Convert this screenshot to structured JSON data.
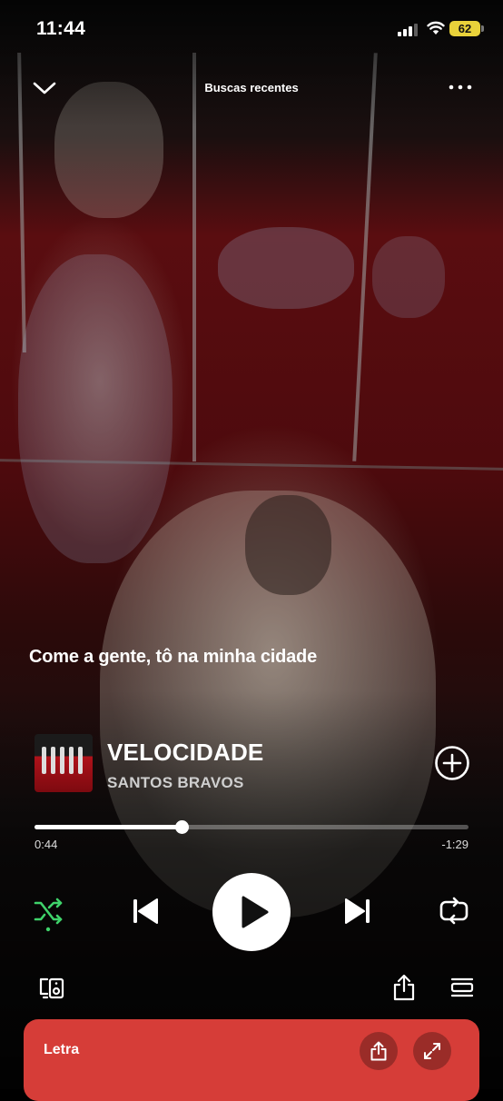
{
  "status_bar": {
    "time": "11:44",
    "battery": "62"
  },
  "header": {
    "title": "Buscas recentes",
    "collapse_icon": "chevron-down-icon",
    "more_icon": "more-icon"
  },
  "lyric_line": "Come a gente, tô na minha cidade",
  "track": {
    "title": "VELOCIDADE",
    "artist": "SANTOS BRAVOS"
  },
  "playback": {
    "elapsed": "0:44",
    "remaining": "-1:29",
    "progress_fraction": 0.338
  },
  "controls": {
    "shuffle_icon": "shuffle-icon",
    "shuffle_color": "#3fd36b",
    "previous_icon": "skip-previous-icon",
    "play_icon": "play-icon",
    "next_icon": "skip-next-icon",
    "repeat_icon": "repeat-icon"
  },
  "footer": {
    "devices_icon": "devices-icon",
    "share_icon": "share-icon",
    "queue_icon": "queue-icon"
  },
  "lyrics_card": {
    "label": "Letra",
    "color": "#d63d38"
  }
}
